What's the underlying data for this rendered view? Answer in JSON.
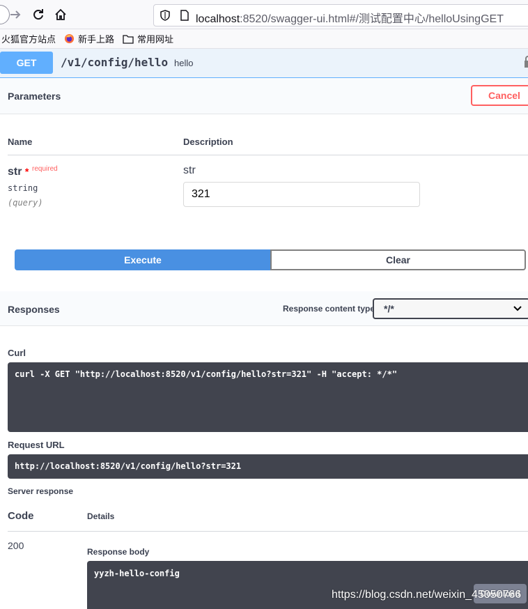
{
  "browser": {
    "url_host": "localhost",
    "url_rest": ":8520/swagger-ui.html#/测试配置中心/helloUsingGET",
    "bookmarks": [
      "火狐官方站点",
      "新手上路",
      "常用网址"
    ]
  },
  "operation": {
    "method": "GET",
    "path": "/v1/config/hello",
    "summary": "hello"
  },
  "parameters": {
    "title": "Parameters",
    "cancel_label": "Cancel",
    "col_name": "Name",
    "col_description": "Description",
    "items": [
      {
        "name": "str",
        "required_mark": "*",
        "required_label": "required",
        "type": "string",
        "in": "(query)",
        "description": "str",
        "value": "321"
      }
    ]
  },
  "actions": {
    "execute_label": "Execute",
    "clear_label": "Clear"
  },
  "responses": {
    "title": "Responses",
    "content_type_label": "Response content type",
    "content_type_value": "*/*",
    "curl_label": "Curl",
    "curl_command": "curl -X GET \"http://localhost:8520/v1/config/hello?str=321\" -H \"accept: */*\"",
    "request_url_label": "Request URL",
    "request_url": "http://localhost:8520/v1/config/hello?str=321",
    "server_response_label": "Server response",
    "code_label": "Code",
    "details_label": "Details",
    "code": "200",
    "response_body_label": "Response body",
    "response_body": "yyzh-hello-config",
    "download_label": "Download"
  },
  "watermark": "https://blog.csdn.net/weixin_45050766",
  "colors": {
    "get_blue": "#61affe",
    "execute_blue": "#4990e2",
    "cancel_red": "#ff6060",
    "code_bg": "#41444e"
  }
}
